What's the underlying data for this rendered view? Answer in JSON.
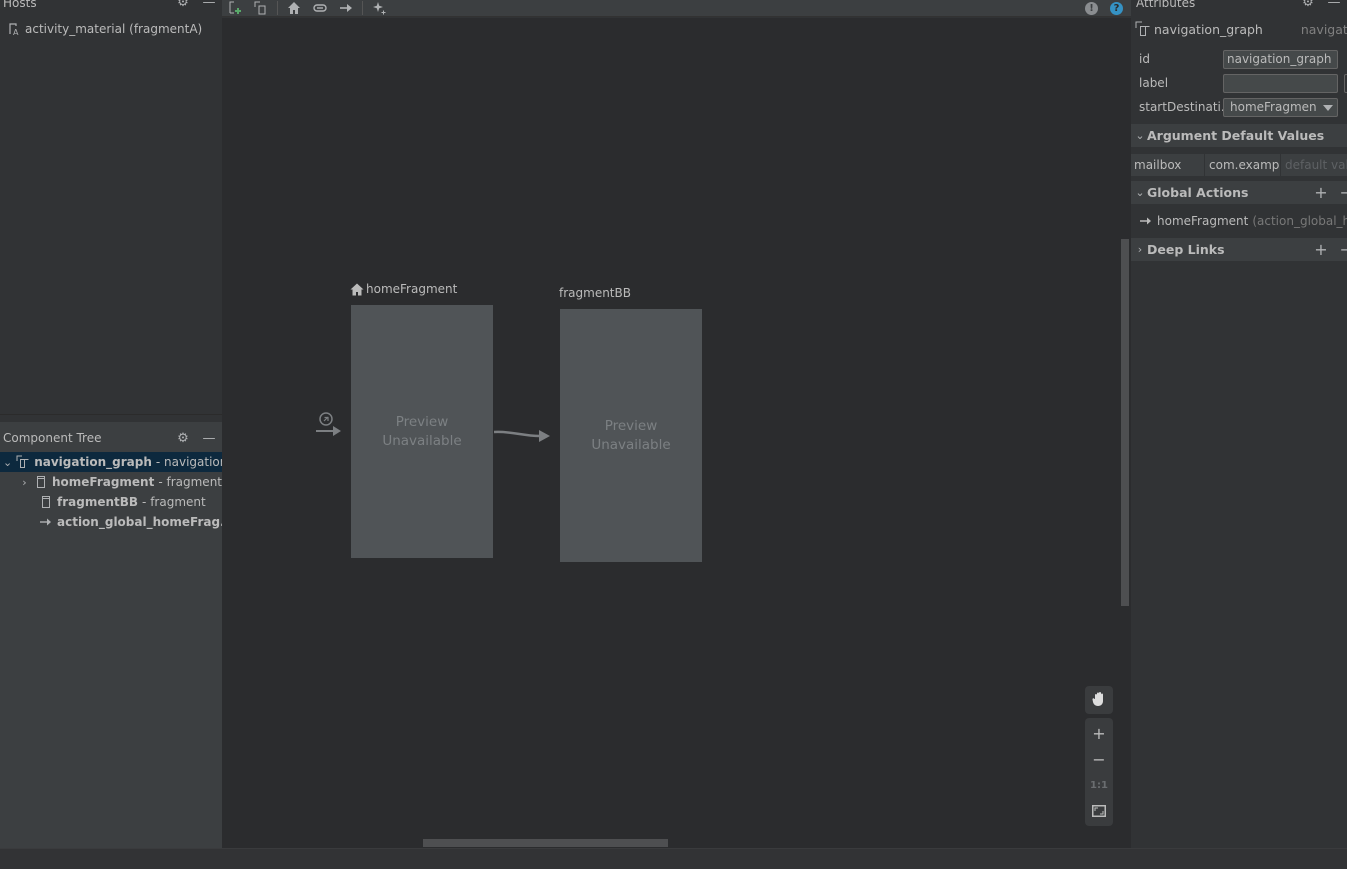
{
  "hosts_panel": {
    "title": "Hosts",
    "items": [
      {
        "icon": "activity-layout-icon",
        "label": "activity_material (fragmentA)"
      }
    ]
  },
  "component_tree": {
    "title": "Component Tree",
    "items": [
      {
        "name": "navigation_graph",
        "type": "- navigation",
        "icon": "nested-graph-icon",
        "expanded": true,
        "selected": true
      },
      {
        "name": "homeFragment",
        "type": "- fragment",
        "icon": "fragment-icon",
        "expandable": true
      },
      {
        "name": "fragmentBB",
        "type": "- fragment",
        "icon": "fragment-icon"
      },
      {
        "name": "action_global_homeFrag...",
        "type": "",
        "icon": "action-arrow-icon"
      }
    ]
  },
  "toolbar": {
    "buttons": [
      {
        "name": "new-destination-button",
        "icon": "new-destination-icon"
      },
      {
        "name": "nested-graph-button",
        "icon": "nested-graph-icon"
      },
      {
        "name": "assign-start-destination-button",
        "icon": "home-icon"
      },
      {
        "name": "deep-link-button",
        "icon": "link-icon"
      },
      {
        "name": "add-action-button",
        "icon": "arrow-right-icon"
      },
      {
        "name": "auto-arrange-button",
        "icon": "sparkle-icon"
      }
    ],
    "right": [
      {
        "name": "warning-button",
        "glyph": "!",
        "color": "#8a8d90"
      },
      {
        "name": "help-button",
        "glyph": "?",
        "color": "#3592c4"
      }
    ]
  },
  "canvas": {
    "destinations": [
      {
        "label": "homeFragment",
        "is_start": true,
        "preview_line1": "Preview",
        "preview_line2": "Unavailable"
      },
      {
        "label": "fragmentBB",
        "is_start": false,
        "preview_line1": "Preview",
        "preview_line2": "Unavailable"
      }
    ],
    "zoom_controls": {
      "pan": "pan-hand-icon",
      "zoom_in": "+",
      "zoom_out": "−",
      "actual_size": "1:1",
      "fit": "fit-screen-icon"
    }
  },
  "attributes_panel": {
    "title": "Attributes",
    "component_name": "navigation_graph",
    "component_type": "navigatio",
    "fields": [
      {
        "label": "id",
        "value": "navigation_graph"
      },
      {
        "label": "label",
        "value": ""
      },
      {
        "label": "startDestinati...",
        "value": "homeFragmen",
        "type": "dropdown"
      }
    ],
    "sections": {
      "argument_defaults": {
        "title": "Argument Default Values",
        "rows": [
          {
            "name": "mailbox",
            "type": "com.examp",
            "default_placeholder": "default valu"
          }
        ]
      },
      "global_actions": {
        "title": "Global Actions",
        "items": [
          {
            "destination": "homeFragment",
            "action": "(action_global_ho"
          }
        ]
      },
      "deep_links": {
        "title": "Deep Links"
      }
    }
  }
}
